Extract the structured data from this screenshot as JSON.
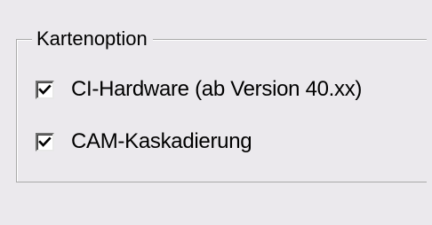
{
  "group": {
    "title": "Kartenoption"
  },
  "options": [
    {
      "label": "CI-Hardware (ab Version 40.xx)",
      "checked": true
    },
    {
      "label": "CAM-Kaskadierung",
      "checked": true
    }
  ],
  "icons": {
    "check": "checkmark-icon"
  }
}
